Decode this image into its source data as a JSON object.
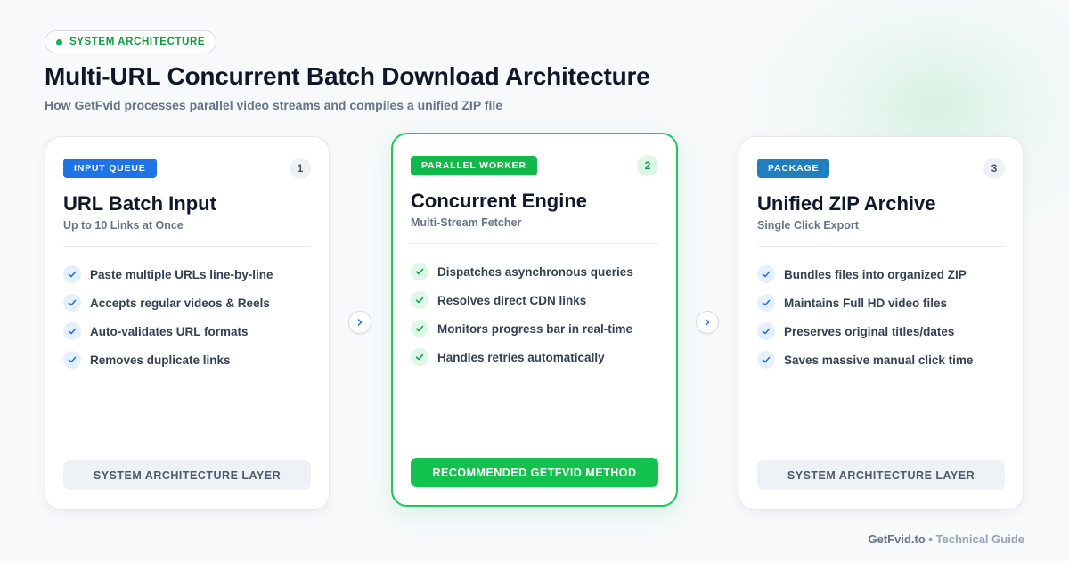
{
  "header": {
    "eyebrow": "SYSTEM ARCHITECTURE",
    "title": "Multi-URL Concurrent Batch Download Architecture",
    "subtitle": "How GetFvid processes parallel video streams and compiles a unified ZIP file"
  },
  "cards": [
    {
      "badge": "INPUT QUEUE",
      "number": "1",
      "title": "URL Batch Input",
      "subtitle": "Up to 10 Links at Once",
      "features": [
        "Paste multiple URLs line-by-line",
        "Accepts regular videos & Reels",
        "Auto-validates URL formats",
        "Removes duplicate links"
      ],
      "footer": "SYSTEM ARCHITECTURE LAYER"
    },
    {
      "badge": "PARALLEL WORKER",
      "number": "2",
      "title": "Concurrent Engine",
      "subtitle": "Multi-Stream Fetcher",
      "features": [
        "Dispatches asynchronous queries",
        "Resolves direct CDN links",
        "Monitors progress bar in real-time",
        "Handles retries automatically"
      ],
      "footer": "RECOMMENDED GETFVID METHOD"
    },
    {
      "badge": "PACKAGE",
      "number": "3",
      "title": "Unified ZIP Archive",
      "subtitle": "Single Click Export",
      "features": [
        "Bundles files into organized ZIP",
        "Maintains Full HD video files",
        "Preserves original titles/dates",
        "Saves massive manual click time"
      ],
      "footer": "SYSTEM ARCHITECTURE LAYER"
    }
  ],
  "footer": {
    "brand": "GetFvid.to",
    "separator": " • ",
    "text": "Technical Guide"
  },
  "colors": {
    "accent_green": "#22c55e",
    "badge_blue": "#1e74e6",
    "badge_teal": "#1f7fbf",
    "badge_green": "#12b84a"
  },
  "icons": {
    "status_dot": "status-dot-icon",
    "check": "check-icon",
    "arrow": "chevron-right-icon"
  }
}
